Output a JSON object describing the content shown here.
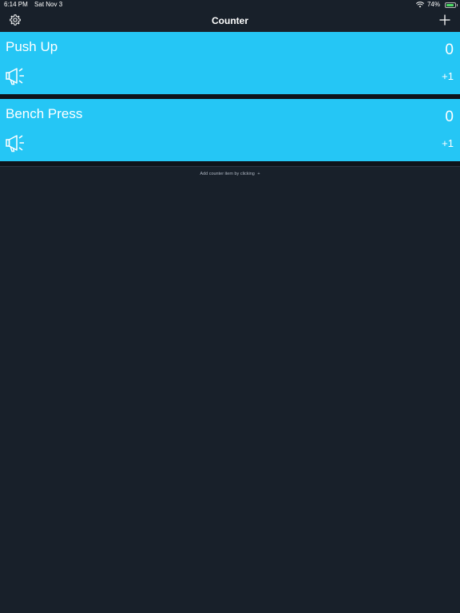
{
  "status_bar": {
    "time": "6:14 PM",
    "date": "Sat Nov 3",
    "battery": "74%",
    "wifi_icon": "wifi-icon",
    "battery_icon": "battery-icon"
  },
  "nav": {
    "title": "Counter",
    "settings_icon": "gear-icon",
    "add_icon": "plus-icon"
  },
  "counters": [
    {
      "name": "Push Up",
      "count": "0",
      "increment": "+1",
      "sound_icon": "megaphone-icon"
    },
    {
      "name": "Bench Press",
      "count": "0",
      "increment": "+1",
      "sound_icon": "megaphone-icon"
    }
  ],
  "hint": {
    "text": "Add counter item by clicking",
    "glyph": "+"
  },
  "colors": {
    "background": "#18202a",
    "card": "#25c6f5",
    "text": "#ffffff"
  }
}
